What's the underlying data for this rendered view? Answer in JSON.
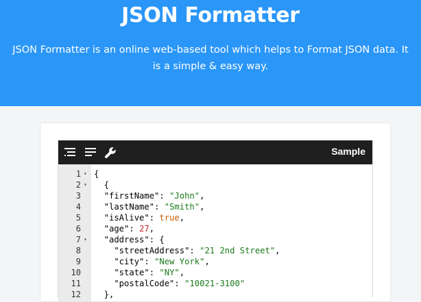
{
  "hero": {
    "title": "JSON Formatter",
    "description": "JSON Formatter is an online web-based tool which helps to Format JSON data. It is a simple & easy way."
  },
  "toolbar": {
    "icons": [
      "format-icon",
      "compact-icon",
      "wrench-icon"
    ],
    "sample_label": "Sample"
  },
  "editor": {
    "lines": [
      {
        "n": "1",
        "fold": true,
        "tokens": [
          {
            "t": "{",
            "c": "p"
          }
        ]
      },
      {
        "n": "2",
        "fold": true,
        "tokens": [
          {
            "t": "  {",
            "c": "p"
          }
        ]
      },
      {
        "n": "3",
        "fold": false,
        "tokens": [
          {
            "t": "  \"firstName\"",
            "c": "k"
          },
          {
            "t": ": ",
            "c": "p"
          },
          {
            "t": "\"John\"",
            "c": "s"
          },
          {
            "t": ",",
            "c": "p"
          }
        ]
      },
      {
        "n": "4",
        "fold": false,
        "tokens": [
          {
            "t": "  \"lastName\"",
            "c": "k"
          },
          {
            "t": ": ",
            "c": "p"
          },
          {
            "t": "\"Smith\"",
            "c": "s"
          },
          {
            "t": ",",
            "c": "p"
          }
        ]
      },
      {
        "n": "5",
        "fold": false,
        "tokens": [
          {
            "t": "  \"isAlive\"",
            "c": "k"
          },
          {
            "t": ": ",
            "c": "p"
          },
          {
            "t": "true",
            "c": "b"
          },
          {
            "t": ",",
            "c": "p"
          }
        ]
      },
      {
        "n": "6",
        "fold": false,
        "tokens": [
          {
            "t": "  \"age\"",
            "c": "k"
          },
          {
            "t": ": ",
            "c": "p"
          },
          {
            "t": "27",
            "c": "n"
          },
          {
            "t": ",",
            "c": "p"
          }
        ]
      },
      {
        "n": "7",
        "fold": true,
        "tokens": [
          {
            "t": "  \"address\"",
            "c": "k"
          },
          {
            "t": ": {",
            "c": "p"
          }
        ]
      },
      {
        "n": "8",
        "fold": false,
        "tokens": [
          {
            "t": "    \"streetAddress\"",
            "c": "k"
          },
          {
            "t": ": ",
            "c": "p"
          },
          {
            "t": "\"21 2nd Street\"",
            "c": "s"
          },
          {
            "t": ",",
            "c": "p"
          }
        ]
      },
      {
        "n": "9",
        "fold": false,
        "tokens": [
          {
            "t": "    \"city\"",
            "c": "k"
          },
          {
            "t": ": ",
            "c": "p"
          },
          {
            "t": "\"New York\"",
            "c": "s"
          },
          {
            "t": ",",
            "c": "p"
          }
        ]
      },
      {
        "n": "10",
        "fold": false,
        "tokens": [
          {
            "t": "    \"state\"",
            "c": "k"
          },
          {
            "t": ": ",
            "c": "p"
          },
          {
            "t": "\"NY\"",
            "c": "s"
          },
          {
            "t": ",",
            "c": "p"
          }
        ]
      },
      {
        "n": "11",
        "fold": false,
        "tokens": [
          {
            "t": "    \"postalCode\"",
            "c": "k"
          },
          {
            "t": ": ",
            "c": "p"
          },
          {
            "t": "\"10021-3100\"",
            "c": "s"
          }
        ]
      },
      {
        "n": "12",
        "fold": false,
        "tokens": [
          {
            "t": "  },",
            "c": "p"
          }
        ]
      }
    ]
  },
  "colors": {
    "hero_bg": "#2a96f8",
    "toolbar_bg": "#1f1f1f",
    "string": "#1a7a1a",
    "boolean": "#c65a00",
    "number": "#c62828"
  }
}
